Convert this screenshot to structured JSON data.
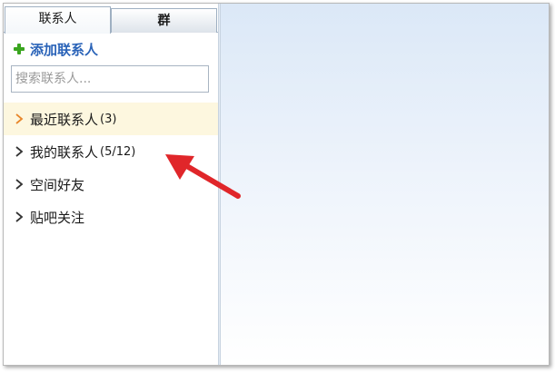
{
  "tabs": [
    {
      "label": "联系人"
    },
    {
      "label": "群"
    }
  ],
  "add_contact": {
    "label": "添加联系人",
    "icon": "plus-icon",
    "color": "#3aa51f"
  },
  "search": {
    "placeholder": "搜索联系人..."
  },
  "contact_groups": [
    {
      "name": "最近联系人",
      "count": "(3)",
      "selected": true,
      "chevron_color": "#e8862a"
    },
    {
      "name": "我的联系人",
      "count": "(5/12)",
      "selected": false,
      "chevron_color": "#333333"
    },
    {
      "name": "空间好友",
      "count": "",
      "selected": false,
      "chevron_color": "#333333"
    },
    {
      "name": "贴吧关注",
      "count": "",
      "selected": false,
      "chevron_color": "#333333"
    }
  ],
  "colors": {
    "accent_link": "#2a63b8",
    "selected_row": "#fdf7df",
    "annotation_arrow": "#e0262a"
  }
}
